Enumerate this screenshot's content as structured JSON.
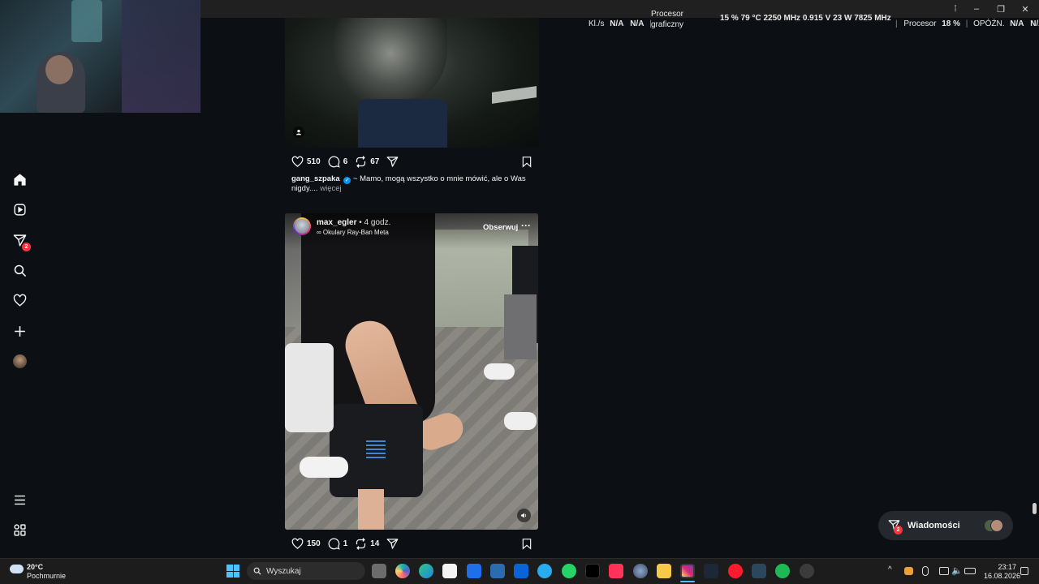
{
  "window": {
    "minimize": "–",
    "restore": "❐",
    "close": "✕",
    "extra": "⁞"
  },
  "hud": {
    "kl_label": "Kl./s",
    "kl_val1": "N/A",
    "kl_val2": "N/A",
    "gpu_label_1": "Procesor",
    "gpu_label_2": "graficzny",
    "gpu_stats": "15 %  79 °C  2250 MHz  0.915 V  23 W  7825 MHz",
    "cpu_label": "Procesor",
    "cpu_val": "18 %",
    "lat_label": "OPÓŹN.",
    "lat_val1": "N/A",
    "lat_val2": "N/A"
  },
  "sidebar": {
    "items": [
      {
        "name": "home-icon"
      },
      {
        "name": "reels-icon"
      },
      {
        "name": "messages-icon",
        "badge": "2"
      },
      {
        "name": "search-icon"
      },
      {
        "name": "notifications-icon"
      },
      {
        "name": "create-icon"
      },
      {
        "name": "profile-avatar"
      }
    ],
    "more": "more-menu-icon",
    "threads": "threads-icon"
  },
  "posts": [
    {
      "likes": "510",
      "comments": "6",
      "reposts": "67",
      "caption_user": "gang_szpaka",
      "caption_text": " ~ Mamo, mogą wszystko o mnie mówić, ale o Was nigdy....",
      "caption_more": " więcej"
    },
    {
      "user": "max_egler",
      "time": " • 4 godz.",
      "subtitle": "∞ Okulary Ray-Ban Meta",
      "follow": "Obserwuj",
      "options": "···",
      "likes": "150",
      "comments": "1",
      "reposts": "14"
    }
  ],
  "messages_pill": {
    "label": "Wiadomości",
    "badge": "2"
  },
  "taskbar": {
    "weather_temp": "20°C",
    "weather_desc": "Pochmurnie",
    "search_placeholder": "Wyszukaj",
    "time": "23:17",
    "date": "16.08.2026"
  },
  "colors": {
    "accent": "#0095f6",
    "badge": "#ff3040",
    "background": "#0c1014"
  }
}
